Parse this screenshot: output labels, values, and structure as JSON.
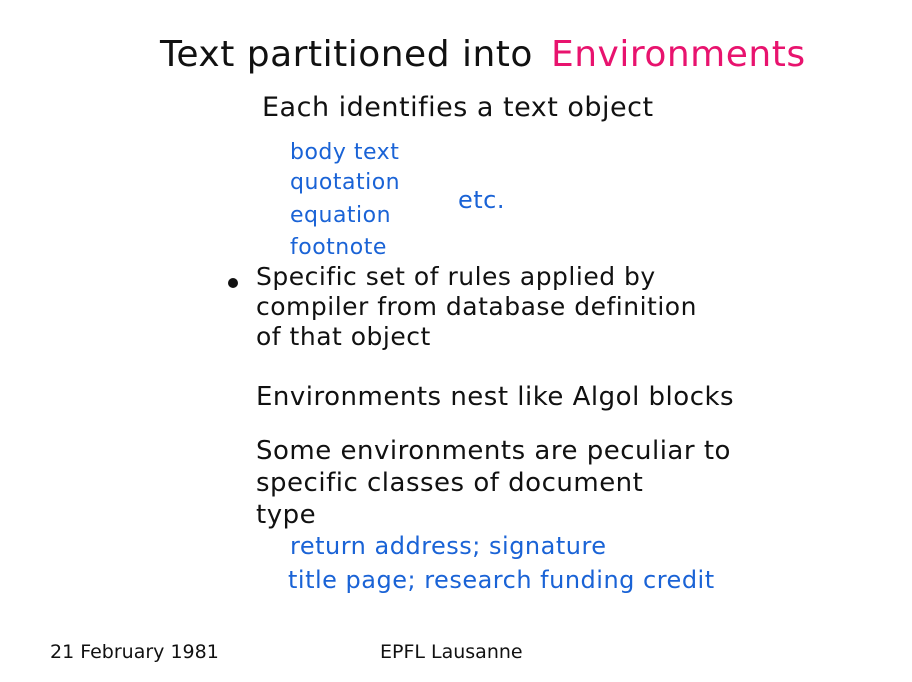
{
  "slide": {
    "title_part1": "Text partitioned into",
    "title_part2": "Environments",
    "line_identifies": "Each identifies a text object",
    "examples": [
      "body text",
      "quotation",
      "equation",
      "footnote"
    ],
    "etc": "etc.",
    "bullet_lines": [
      "Specific set of rules applied by",
      "compiler from database definition",
      "of that object"
    ],
    "nest_line": "Environments nest like Algol blocks",
    "peculiar_lines": [
      "Some environments are peculiar to",
      "specific classes of document",
      "type"
    ],
    "peculiar_examples": [
      "return address; signature",
      "title page; research funding credit"
    ],
    "colors": {
      "ink": "#111111",
      "blue": "#1a63d6",
      "pink": "#e8136e"
    }
  },
  "footer": {
    "date": "21 February 1981",
    "location": "EPFL Lausanne"
  }
}
